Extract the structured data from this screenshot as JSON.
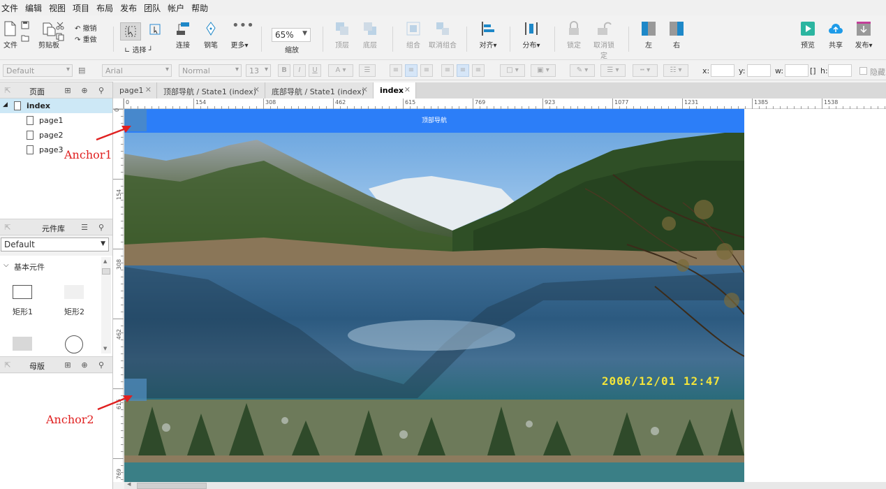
{
  "menu": [
    "文件",
    "编辑",
    "视图",
    "项目",
    "布局",
    "发布",
    "团队",
    "帐户",
    "帮助"
  ],
  "toolbar": {
    "file": "文件",
    "clipboard": "剪贴板",
    "undo": "撤销",
    "redo": "重做",
    "select": "选择",
    "connect": "连接",
    "pen": "钢笔",
    "more": "更多▾",
    "zoom_value": "65%",
    "zoom_label": "缩放",
    "top_layer": "顶层",
    "bottom_layer": "底层",
    "group": "组合",
    "ungroup": "取消组合",
    "align": "对齐▾",
    "distribute": "分布▾",
    "lock": "锁定",
    "unlock": "取消锁定",
    "left": "左",
    "right": "右",
    "preview": "预览",
    "share": "共享",
    "publish": "发布▾"
  },
  "format": {
    "style": "Default",
    "font": "Arial",
    "weight": "Normal",
    "size": "13",
    "x_label": "x:",
    "y_label": "y:",
    "w_label": "w:",
    "h_label": "h:",
    "hidden_label": "隐藏"
  },
  "pages_panel": {
    "title": "页面",
    "root": "index",
    "items": [
      "page1",
      "page2",
      "page3"
    ]
  },
  "library_panel": {
    "title": "元件库",
    "selected": "Default",
    "section": "基本元件",
    "widgets": [
      "矩形1",
      "矩形2"
    ]
  },
  "masters_panel": {
    "title": "母版"
  },
  "tabs": [
    {
      "label": "page1"
    },
    {
      "label": "顶部导航 / State1 (index)"
    },
    {
      "label": "底部导航 / State1 (index)"
    },
    {
      "label": "index"
    }
  ],
  "ruler_h": [
    "0",
    "154",
    "308",
    "462",
    "615",
    "769",
    "923",
    "1077",
    "1231",
    "1385",
    "1538"
  ],
  "ruler_v": [
    "0",
    "154",
    "308",
    "462",
    "615",
    "769"
  ],
  "canvas": {
    "nav_text": "顶部导航",
    "timestamp": "2006/12/01 12:47"
  },
  "annotations": {
    "anchor1": "Anchor1",
    "anchor2": "Anchor2"
  },
  "colors": {
    "nav_blue": "#2c7ef8",
    "accent_red": "#e02020",
    "stamp_yellow": "#f3e43a"
  }
}
